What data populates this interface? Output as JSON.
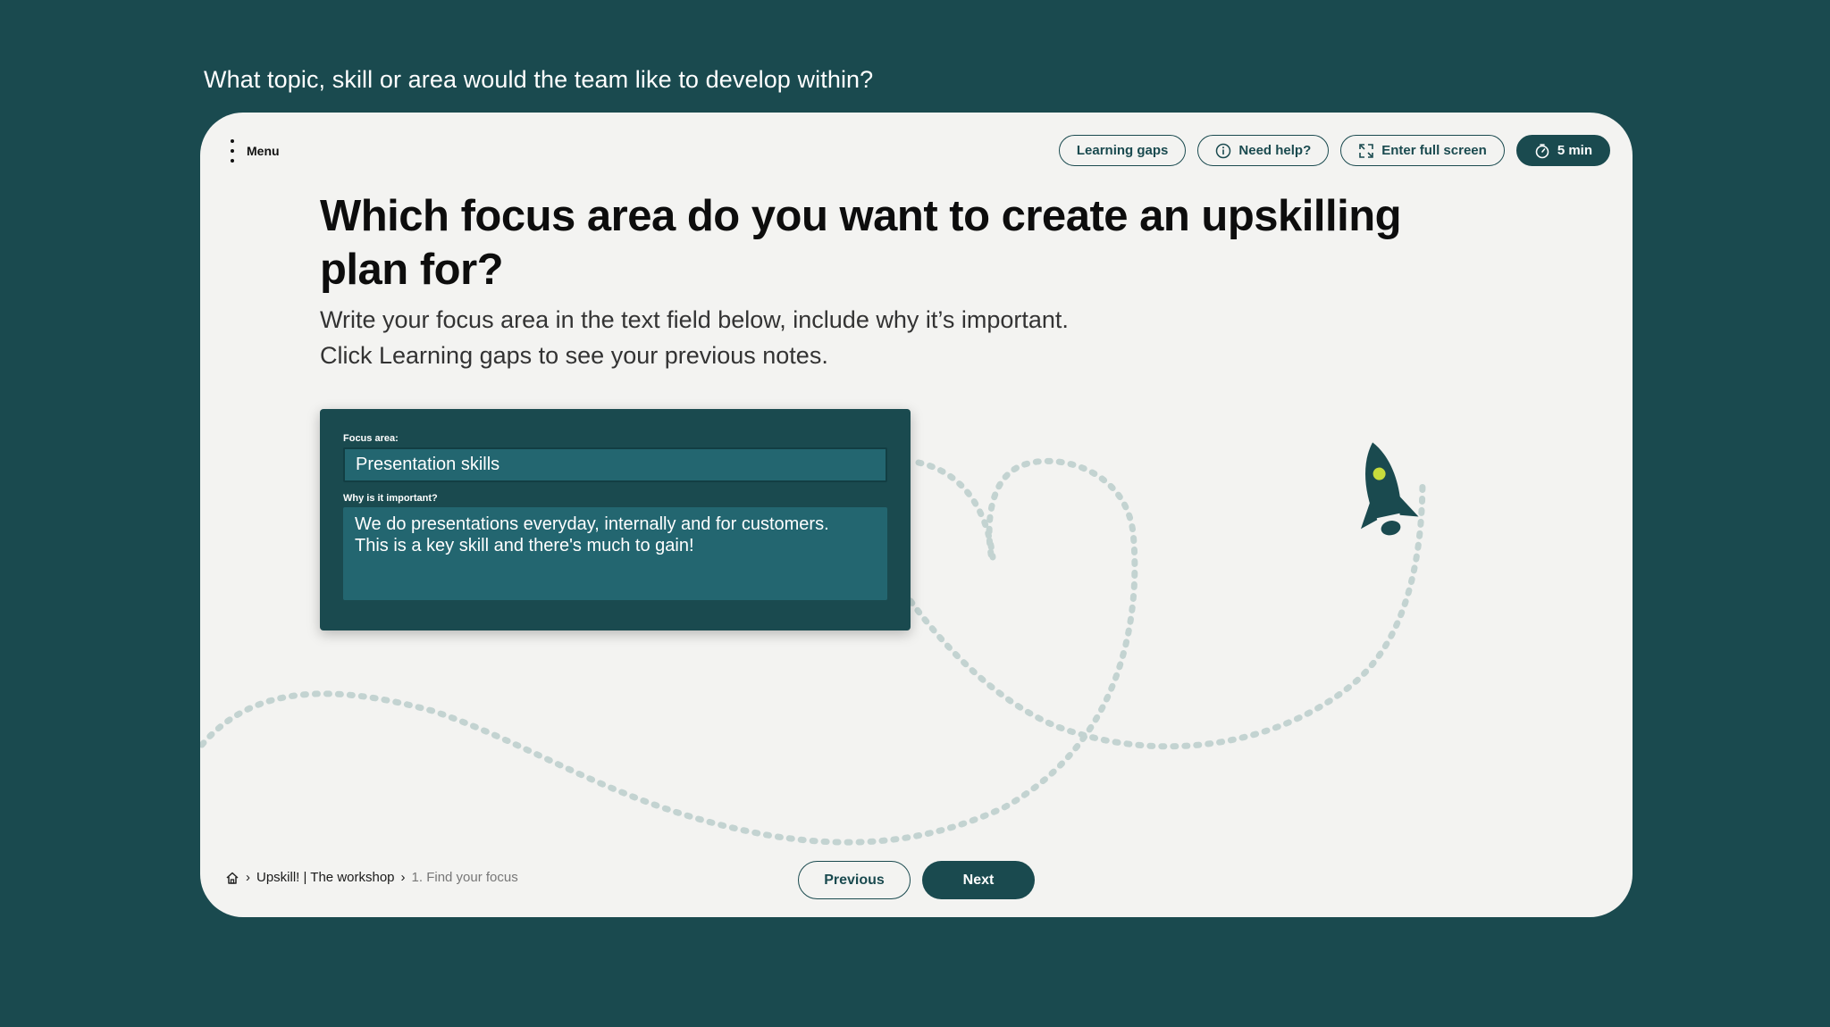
{
  "caption": "What topic, skill or area would the team like to develop within?",
  "menu": {
    "label": "Menu"
  },
  "topbar": {
    "learning_gaps": "Learning gaps",
    "need_help": "Need help?",
    "full_screen": "Enter full screen",
    "timer": "5 min"
  },
  "heading": "Which focus area do you want to create an upskilling plan for?",
  "subtitle": {
    "line1": "Write your focus area in the text field below, include why it’s important.",
    "line2": "Click Learning gaps to see your previous notes."
  },
  "form": {
    "focus_label": "Focus area:",
    "focus_value": "Presentation skills",
    "why_label": "Why is it important?",
    "why_value_line1": "We do presentations everyday, internally and for customers.",
    "why_value_line2": "This is a key skill and there's much to gain!"
  },
  "breadcrumb": {
    "item1": "Upskill! | The workshop",
    "item2": "1. Find your focus"
  },
  "nav": {
    "previous": "Previous",
    "next": "Next"
  },
  "colors": {
    "brand": "#1a4a4f",
    "field": "#236670",
    "accent": "#c8dc3c",
    "card": "#f3f3f1"
  }
}
